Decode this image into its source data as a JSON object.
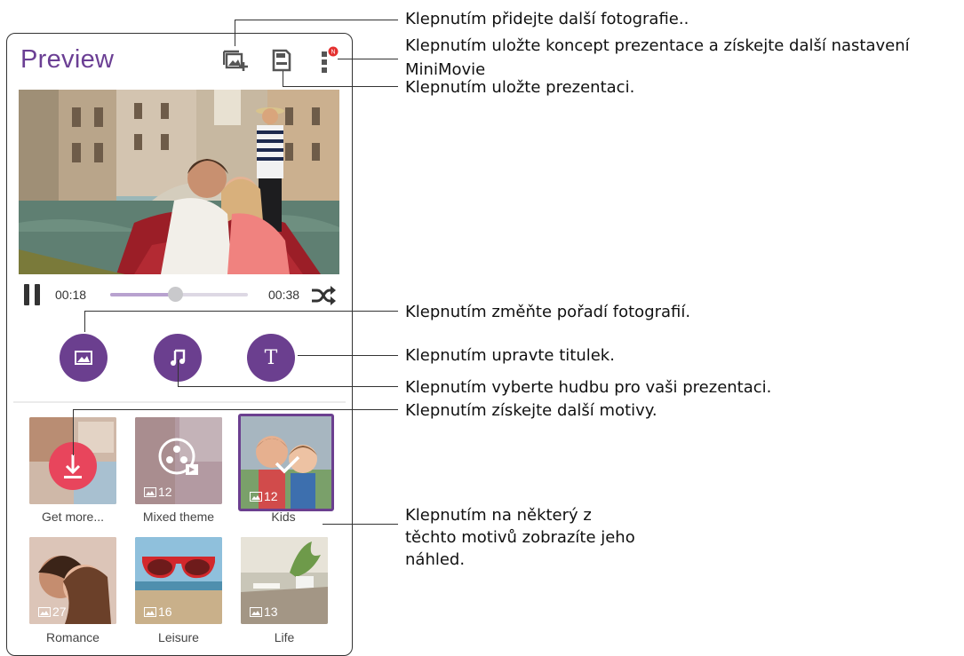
{
  "app": {
    "title": "Preview",
    "icons": [
      "add-photo-icon",
      "save-icon",
      "more-icon"
    ],
    "notification_badge": "N",
    "accent_color": "#6b3f94"
  },
  "player": {
    "elapsed": "00:18",
    "total": "00:38",
    "progress": 0.47
  },
  "tools": [
    {
      "name": "photo-order",
      "icon": "image-icon"
    },
    {
      "name": "music",
      "icon": "music-note-icon"
    },
    {
      "name": "caption",
      "icon": "text-icon",
      "glyph": "T"
    }
  ],
  "themes": [
    {
      "label": "Get more...",
      "count": ""
    },
    {
      "label": "Mixed theme",
      "count": "12"
    },
    {
      "label": "Kids",
      "count": "12",
      "selected": true
    },
    {
      "label": "Romance",
      "count": "27"
    },
    {
      "label": "Leisure",
      "count": "16"
    },
    {
      "label": "Life",
      "count": "13"
    }
  ],
  "callouts": {
    "add_photos": "Klepnutím přidejte další fotografie..",
    "save_draft": "Klepnutím uložte koncept prezentace a získejte další nastavení",
    "save_draft_cont": "MiniMovie",
    "save_presentation": "Klepnutím uložte prezentaci.",
    "reorder": "Klepnutím změňte pořadí fotografií.",
    "edit_caption": "Klepnutím upravte titulek.",
    "choose_music": "Klepnutím vyberte hudbu pro vaši prezentaci.",
    "more_themes": "Klepnutím získejte další motivy.",
    "theme_preview": "Klepnutím na některý z těchto motivů zobrazíte jeho náhled."
  }
}
